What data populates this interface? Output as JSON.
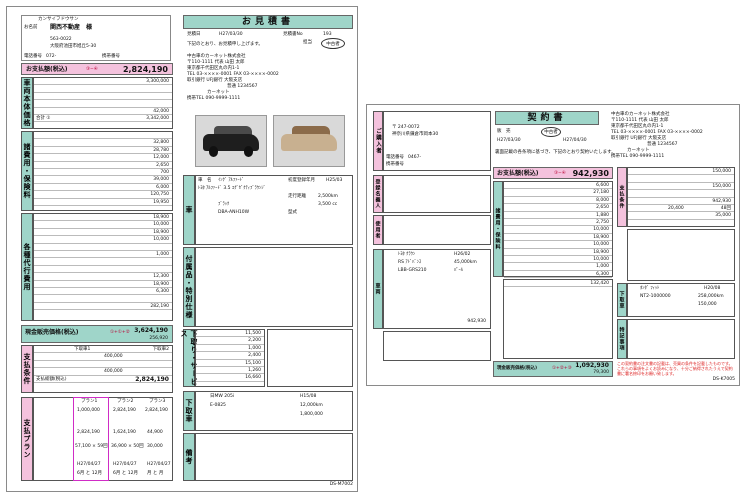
{
  "left_doc": {
    "title": "お見積書",
    "customer_furigana": "カンサイフドウサン",
    "customer_label": "お名前",
    "customer_name": "関西不動産　様",
    "postal": "563-0022",
    "address": "大阪府池田市旭丘5-30",
    "phone_label": "電話番号",
    "phone": "072-",
    "mobile_label": "携帯番号",
    "estimate_date_label": "見積日",
    "estimate_date": "H27/03/30",
    "estimate_no_label": "見積書No",
    "estimate_no": "193",
    "rep_label": "担当",
    "rep_name": "中古者",
    "greeting": "下記のとおり、お見積申し上げます。",
    "dealer_name": "中古車のカーネット株式会社",
    "dealer_address": "〒110-1111 代表 山田 太郎",
    "dealer_address2": "東京都千代田区丸の内1-1",
    "dealer_tel": "TEL 03-××××-0001 FAX 03-××××-0002",
    "bank": "取引銀行 UFJ銀行 大阪支店",
    "account": "普通 1234567",
    "dealer_sign": "カーネット",
    "dealer_tel2": "携帯TEL 090-9999-1111",
    "total_label": "お支払額(税込)",
    "total_formula": "③−④",
    "total_value": "2,824,190",
    "vehicle_section": "車両本体価格",
    "vehicle_price": "3,300,000",
    "discount": "42,000",
    "subtotal_label": "合計 ①",
    "subtotal_value": "3,342,000",
    "misc_section": "諸費用・保険料",
    "misc_values": [
      "32,800",
      "28,780",
      "12,000",
      "2,650",
      "700",
      "39,000",
      "6,000",
      "120,750"
    ],
    "misc_subtotal": "19,950",
    "fees_section": "各種代行費用",
    "fees_values": [
      "18,900",
      "10,000",
      "18,900",
      "10,000",
      "1,000",
      "12,300",
      "18,900",
      "6,300"
    ],
    "fees_subtotal": "282,190",
    "model_label": "車　名",
    "model_value": "ｲﾝｸﾞ ｱﾙﾌｧｰﾄﾞ",
    "grade_value": "ﾄﾖﾀ ｱﾙﾌｧｰﾄﾞ 3.5 ｴｸﾞｾﾞｸﾃｨﾌﾞﾗｳﾝｼﾞ",
    "year_label": "初度登録年月",
    "year_value": "H25/03",
    "mileage_label": "走行距離",
    "mileage_value": "2,500km",
    "color_value": "ﾌﾞﾗｯｸ",
    "displacement": "3,500 cc",
    "chassis_label": "型式",
    "chassis_value": "DBA-ANH10W",
    "options_section": "付属品・特別仕様",
    "tradein_section": "下取り・サービス",
    "tradein_values": [
      "11,500",
      "2,200",
      "1,000",
      "2,400",
      "15,100",
      "1,260",
      "16,660"
    ],
    "cash_label": "現金販売価格(税込)",
    "cash_formula": "①+①+②",
    "cash_value": "3,624,190",
    "cash_tax": "256,920",
    "tradein_col1": "下取車1",
    "tradein_col2": "下取車2",
    "tradein_price": "400,000",
    "tradein_total": "400,000",
    "payment_section": "支払条件",
    "payment_total_label": "支払総額(税込)",
    "payment_total": "2,824,190",
    "plan_section": "支払プラン",
    "plan_headers": [
      "プラン1",
      "プラン2",
      "プラン3"
    ],
    "plan_down": [
      "1,000,000",
      "2,824,190",
      "2,824,190"
    ],
    "plan_values": [
      "2,824,190",
      "1,624,190",
      "44,900"
    ],
    "plan_months": [
      "57,100 × 59回",
      "36,900 × 50回",
      "30,000"
    ],
    "plan_dates": [
      "H27/04/27",
      "H27/04/27",
      "H27/04/27"
    ],
    "plan_end": [
      "6月 と 12月",
      "6月 と 12月",
      "月 と 月"
    ],
    "trade_car_label": "下取車",
    "trade_car_value": "日MW 205i",
    "trade_car_year": "H15/08",
    "trade_car_no": "E-0825",
    "trade_car_km": "12,000km",
    "trade_car_price": "1,800,000",
    "form_code": "DS-M7002",
    "remarks_label": "備考"
  },
  "right_doc": {
    "title": "契約書",
    "buyer_section": "ご購入者",
    "buyer_postal": "〒 247-0072",
    "buyer_address": "神奈川県鎌倉市岡本30",
    "phone_label": "電話番号",
    "phone": "0467-",
    "mobile_label": "携帯番号",
    "contract_no_label": "契約書No",
    "contract_no": "193",
    "sales_label": "販　売",
    "sales_rep": "中古者",
    "contract_date": "H27/03/30",
    "delivery_date": "H27/04/30",
    "note": "裏面記載の各条項に基づき、下記のとおり契約いたします。",
    "dealer_name": "中古車のカーネット株式会社",
    "dealer_address": "〒110-1111 代表 山田 太郎",
    "dealer_address2": "東京都千代田区丸の内1-1",
    "dealer_tel": "TEL 03-××××-0001 FAX 03-××××-0002",
    "bank": "取引銀行 UFJ銀行 大阪支店",
    "account": "普通 1234567",
    "dealer_sign": "カーネット",
    "dealer_tel2": "携帯TEL 090-9999-1111",
    "owner_section": "登録名義人",
    "user_section": "使用者",
    "total_label": "お支払額(税込)",
    "total_formula": "③−④",
    "total_value": "942,930",
    "misc_section": "諸費用・保険料",
    "misc_values": [
      "6,600",
      "27,180",
      "8,000",
      "2,650",
      "1,880",
      "2,750",
      "10,000"
    ],
    "fees_values": [
      "18,900",
      "10,000",
      "18,900",
      "10,000",
      "1,000",
      "6,300"
    ],
    "fees_subtotal": "132,420",
    "car_section": "車両",
    "car_model": "ﾄﾖﾀ ｸﾗｳﾝ",
    "car_grade": "RS ｱﾄﾞﾊﾞﾝｽ",
    "car_year": "H26/02",
    "car_km": "45,000km",
    "car_chassis": "LBB-GRS210",
    "car_color": "ﾊﾟｰﾙ",
    "car_price": "942,930",
    "payment_section": "支払条件",
    "payment_values": [
      "150,000",
      "150,000",
      "942,930"
    ],
    "installment": "20,400",
    "installment_count": "48回",
    "bonus_amount": "35,000",
    "tradein_section": "下取車",
    "trade_car": "ﾎﾝﾀﾞ ﾌｨｯﾄ",
    "trade_no": "NT2-1000000",
    "trade_km": "258,000km",
    "trade_price": "150,000",
    "trade_year": "H20/08",
    "cash_label": "現金販売価格(税込)",
    "cash_formula": "①+②+③",
    "cash_value": "1,092,930",
    "cash_tax": "79,300",
    "remarks_section": "特記事項",
    "warning": "この契約書の注文書の記載は、売買の条件を記載したものです。これらの事項をよくお読みになり、十分ご納得されたうえで契約書に署名捺印をお願い致します。",
    "form_code": "DS-K7005"
  }
}
